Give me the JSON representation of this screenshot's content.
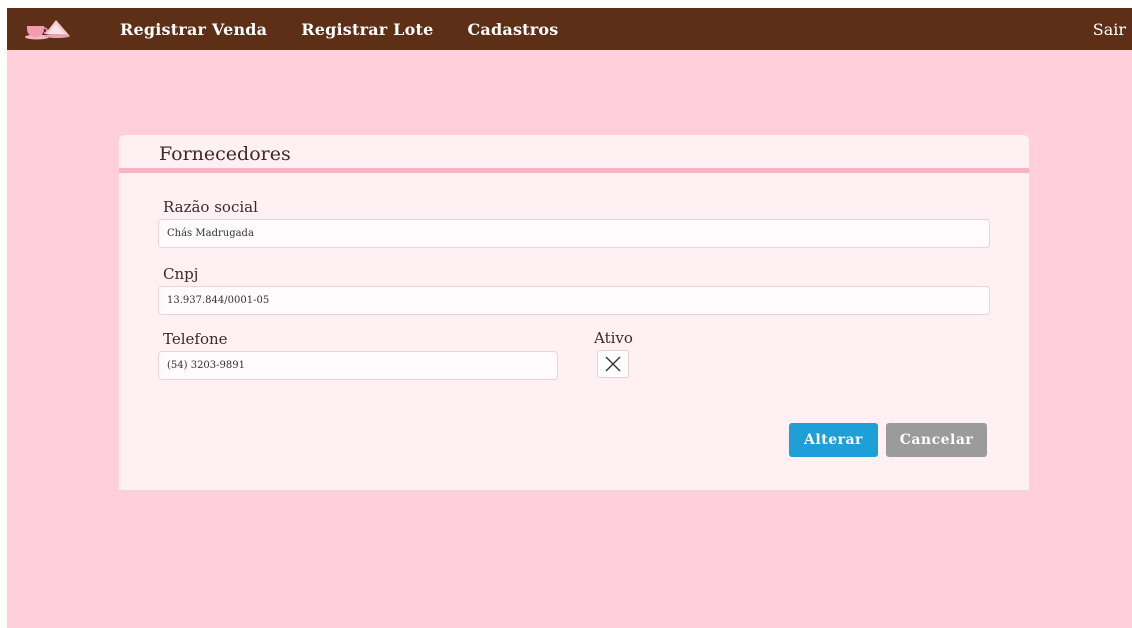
{
  "navbar": {
    "logo_icon": "teacup-and-cake-icon",
    "links": [
      "Registrar Venda",
      "Registrar Lote",
      "Cadastros"
    ],
    "logout": "Sair",
    "background": "#5e2f17"
  },
  "card": {
    "title": "Fornecedores",
    "fields": {
      "razao_social": {
        "label": "Razão social",
        "value": "Chás Madrugada"
      },
      "cnpj": {
        "label": "Cnpj",
        "value": "13.937.844/0001-05"
      },
      "telefone": {
        "label": "Telefone",
        "value": "(54) 3203-9891"
      }
    },
    "ativo": {
      "label": "Ativo",
      "checked": true,
      "icon": "x-mark-icon"
    },
    "buttons": {
      "primary": "Alterar",
      "secondary": "Cancelar"
    }
  },
  "colors": {
    "page_background": "#ffd0dc",
    "card_background": "#fff0f3",
    "divider": "#f4b6c2",
    "primary_button": "#1e9fd8",
    "secondary_button": "#9b9b9b"
  }
}
